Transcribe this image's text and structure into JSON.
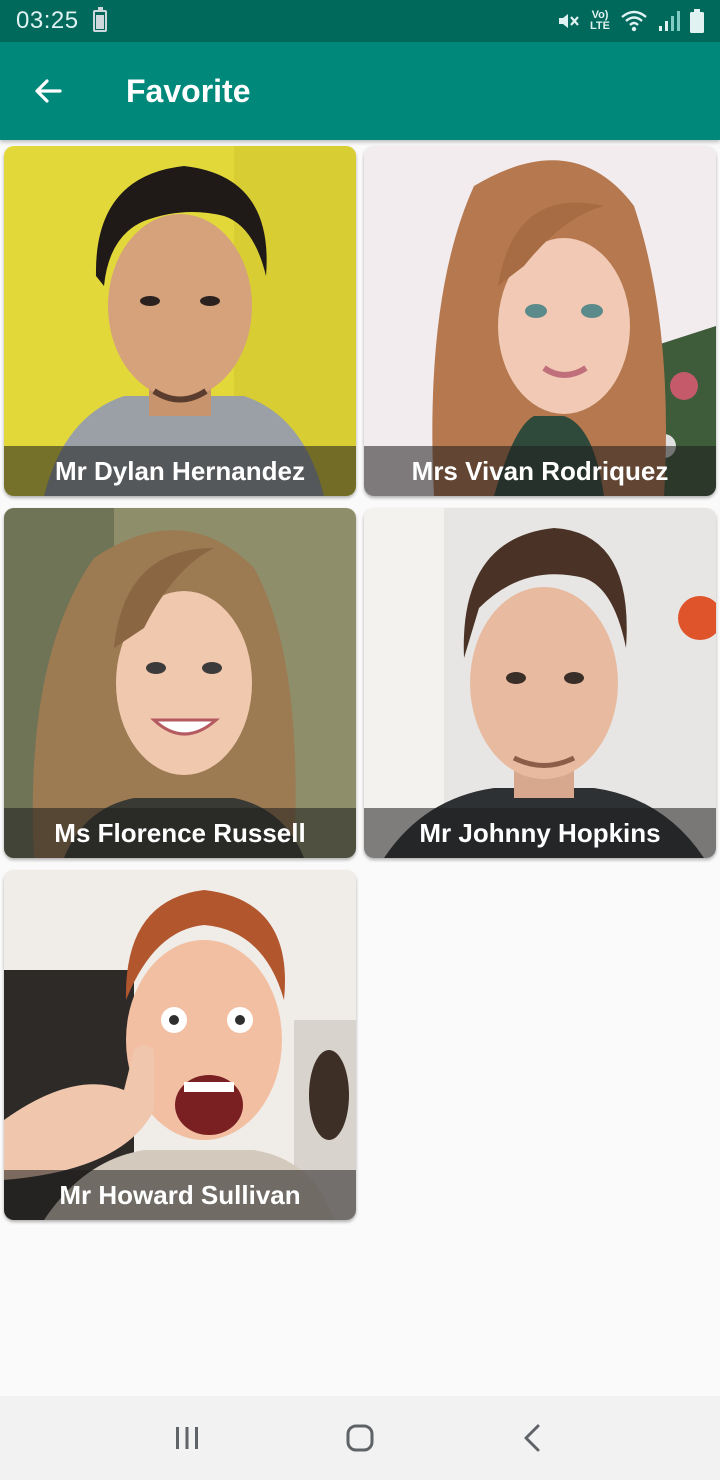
{
  "status_bar": {
    "time": "03:25",
    "battery_label": "100",
    "network_label": "LTE",
    "icons": [
      "battery-icon",
      "mute-icon",
      "volte-icon",
      "wifi-icon",
      "signal-icon",
      "battery-full-icon"
    ]
  },
  "app_bar": {
    "title": "Favorite",
    "back_icon": "arrow-back-icon",
    "background": "#00897b",
    "status_background": "#00695c"
  },
  "favorites": [
    {
      "name": "Mr Dylan Hernandez",
      "photo_bg": "#e3d83a"
    },
    {
      "name": "Mrs Vivan Rodriquez",
      "photo_bg": "#f3ecef"
    },
    {
      "name": "Ms Florence Russell",
      "photo_bg": "#8e8e6a"
    },
    {
      "name": "Mr Johnny Hopkins",
      "photo_bg": "#e8e6e4"
    },
    {
      "name": "Mr Howard Sullivan",
      "photo_bg": "#f0ece8"
    }
  ],
  "nav_bar": {
    "icons": [
      "recents-icon",
      "home-icon",
      "back-icon"
    ]
  }
}
